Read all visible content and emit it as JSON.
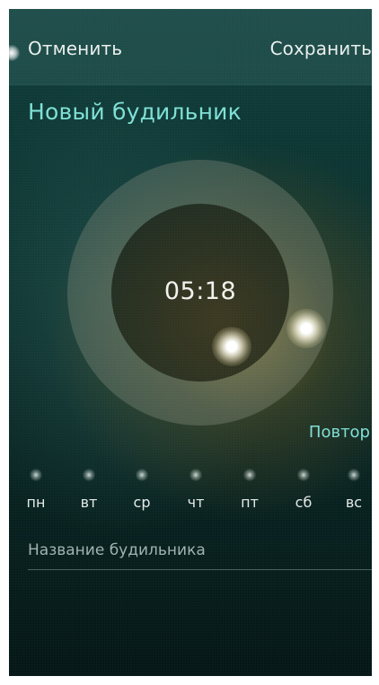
{
  "header": {
    "cancel_label": "Отменить",
    "save_label": "Сохранить"
  },
  "title": "Новый будильник",
  "clock": {
    "time": "05:18"
  },
  "repeat": {
    "label": "Повтор",
    "days": [
      "пн",
      "вт",
      "ср",
      "чт",
      "пт",
      "сб",
      "вс"
    ]
  },
  "alarm_name": {
    "placeholder": "Название будильника",
    "value": ""
  },
  "colors": {
    "accent": "#7fe0d6",
    "background": "#0d3431"
  },
  "icons": {
    "hour_handle": "glow-dot",
    "minute_handle": "glow-dot",
    "day_indicator": "glow-dot"
  }
}
